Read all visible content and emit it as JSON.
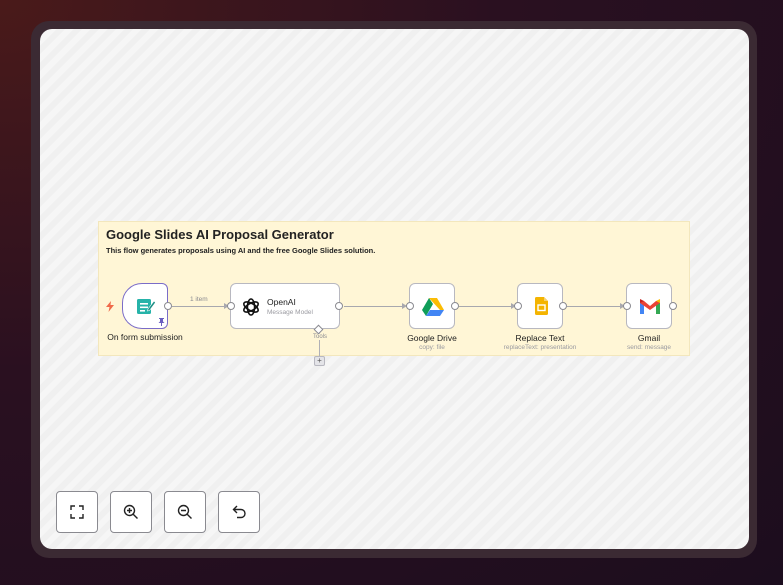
{
  "canvas": {
    "sticky": {
      "title": "Google Slides AI Proposal Generator",
      "description": "This flow generates proposals using AI and the free Google Slides solution."
    },
    "nodes": [
      {
        "id": "form",
        "label": "On form submission",
        "subtitle": "",
        "icon": "form-icon"
      },
      {
        "id": "openai",
        "label": "OpenAI",
        "subtitle": "Message Model",
        "icon": "openai-icon"
      },
      {
        "id": "drive",
        "label": "Google Drive",
        "subtitle": "copy: file",
        "icon": "google-drive-icon"
      },
      {
        "id": "replace",
        "label": "Replace Text",
        "subtitle": "replaceText: presentation",
        "icon": "google-slides-icon"
      },
      {
        "id": "gmail",
        "label": "Gmail",
        "subtitle": "send: message",
        "icon": "gmail-icon"
      }
    ],
    "edge_labels": {
      "form_to_openai": "1 item"
    },
    "tools_label": "Tools",
    "add_tool_label": "+"
  },
  "controls": [
    {
      "name": "fit-view",
      "icon": "fullscreen-icon"
    },
    {
      "name": "zoom-in",
      "icon": "zoom-in-icon"
    },
    {
      "name": "zoom-out",
      "icon": "zoom-out-icon"
    },
    {
      "name": "reset",
      "icon": "undo-icon"
    }
  ],
  "colors": {
    "sticky_bg": "#fff6d6",
    "trigger_border": "#7a6cc8",
    "lightning": "#f06a4a"
  }
}
